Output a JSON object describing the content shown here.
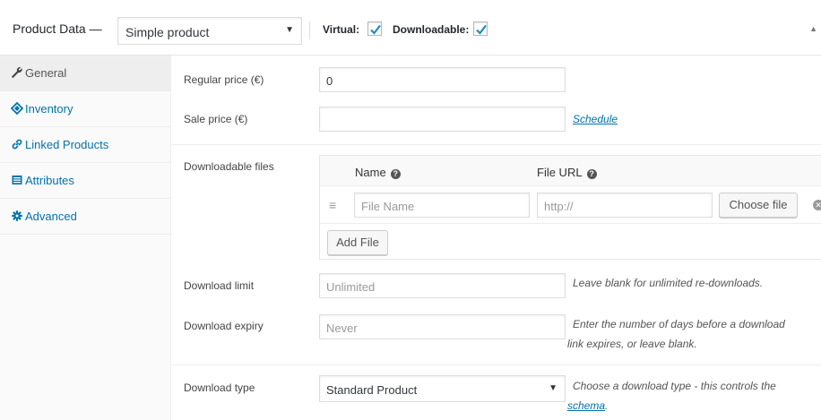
{
  "header": {
    "title": "Product Data —",
    "product_type": "Simple product",
    "virtual_label": "Virtual:",
    "virtual_checked": true,
    "downloadable_label": "Downloadable:",
    "downloadable_checked": true
  },
  "sidebar": {
    "items": [
      {
        "label": "General",
        "icon": "wrench-icon",
        "active": true
      },
      {
        "label": "Inventory",
        "icon": "tag-icon",
        "active": false
      },
      {
        "label": "Linked Products",
        "icon": "link-icon",
        "active": false
      },
      {
        "label": "Attributes",
        "icon": "list-icon",
        "active": false
      },
      {
        "label": "Advanced",
        "icon": "gear-icon",
        "active": false
      }
    ]
  },
  "general": {
    "regular_price_label": "Regular price (€)",
    "regular_price_value": "0",
    "sale_price_label": "Sale price (€)",
    "sale_price_value": "",
    "schedule_link": "Schedule",
    "downloadable_files_label": "Downloadable files",
    "files_table": {
      "name_header": "Name",
      "url_header": "File URL",
      "name_placeholder": "File Name",
      "url_placeholder": "http://",
      "choose_file": "Choose file",
      "add_file": "Add File"
    },
    "download_limit_label": "Download limit",
    "download_limit_placeholder": "Unlimited",
    "download_limit_desc": "Leave blank for unlimited re-downloads.",
    "download_expiry_label": "Download expiry",
    "download_expiry_placeholder": "Never",
    "download_expiry_desc_1": "Enter the number of days before a download",
    "download_expiry_desc_2": "link expires, or leave blank.",
    "download_type_label": "Download type",
    "download_type_value": "Standard Product",
    "download_type_desc_1": "Choose a download type - this controls the",
    "download_type_desc_link": "schema",
    "download_type_desc_end": "."
  }
}
